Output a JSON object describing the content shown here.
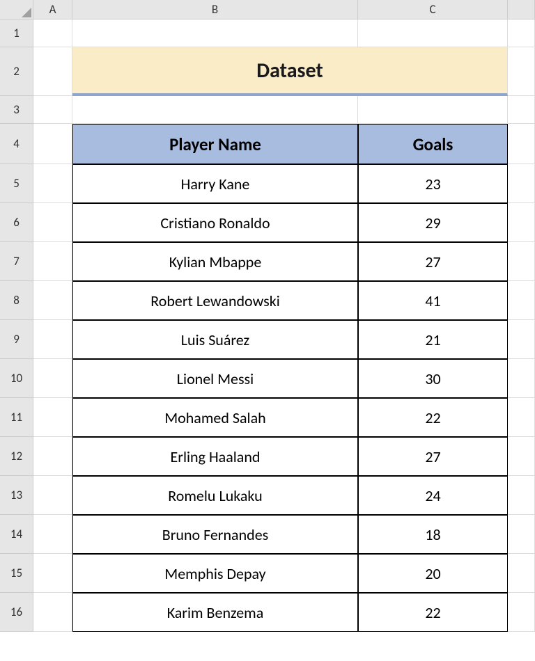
{
  "columns": [
    "A",
    "B",
    "C"
  ],
  "rowNumbers": [
    "1",
    "2",
    "3",
    "4",
    "5",
    "6",
    "7",
    "8",
    "9",
    "10",
    "11",
    "12",
    "13",
    "14",
    "15",
    "16"
  ],
  "title": "Dataset",
  "headers": {
    "col1": "Player Name",
    "col2": "Goals"
  },
  "rows": [
    {
      "player": "Harry Kane",
      "goals": "23"
    },
    {
      "player": "Cristiano Ronaldo",
      "goals": "29"
    },
    {
      "player": "Kylian Mbappe",
      "goals": "27"
    },
    {
      "player": "Robert Lewandowski",
      "goals": "41"
    },
    {
      "player": "Luis Suárez",
      "goals": "21"
    },
    {
      "player": "Lionel Messi",
      "goals": "30"
    },
    {
      "player": "Mohamed Salah",
      "goals": "22"
    },
    {
      "player": "Erling Haaland",
      "goals": "27"
    },
    {
      "player": "Romelu Lukaku",
      "goals": "24"
    },
    {
      "player": "Bruno Fernandes",
      "goals": "18"
    },
    {
      "player": "Memphis Depay",
      "goals": "20"
    },
    {
      "player": "Karim Benzema",
      "goals": "22"
    }
  ]
}
